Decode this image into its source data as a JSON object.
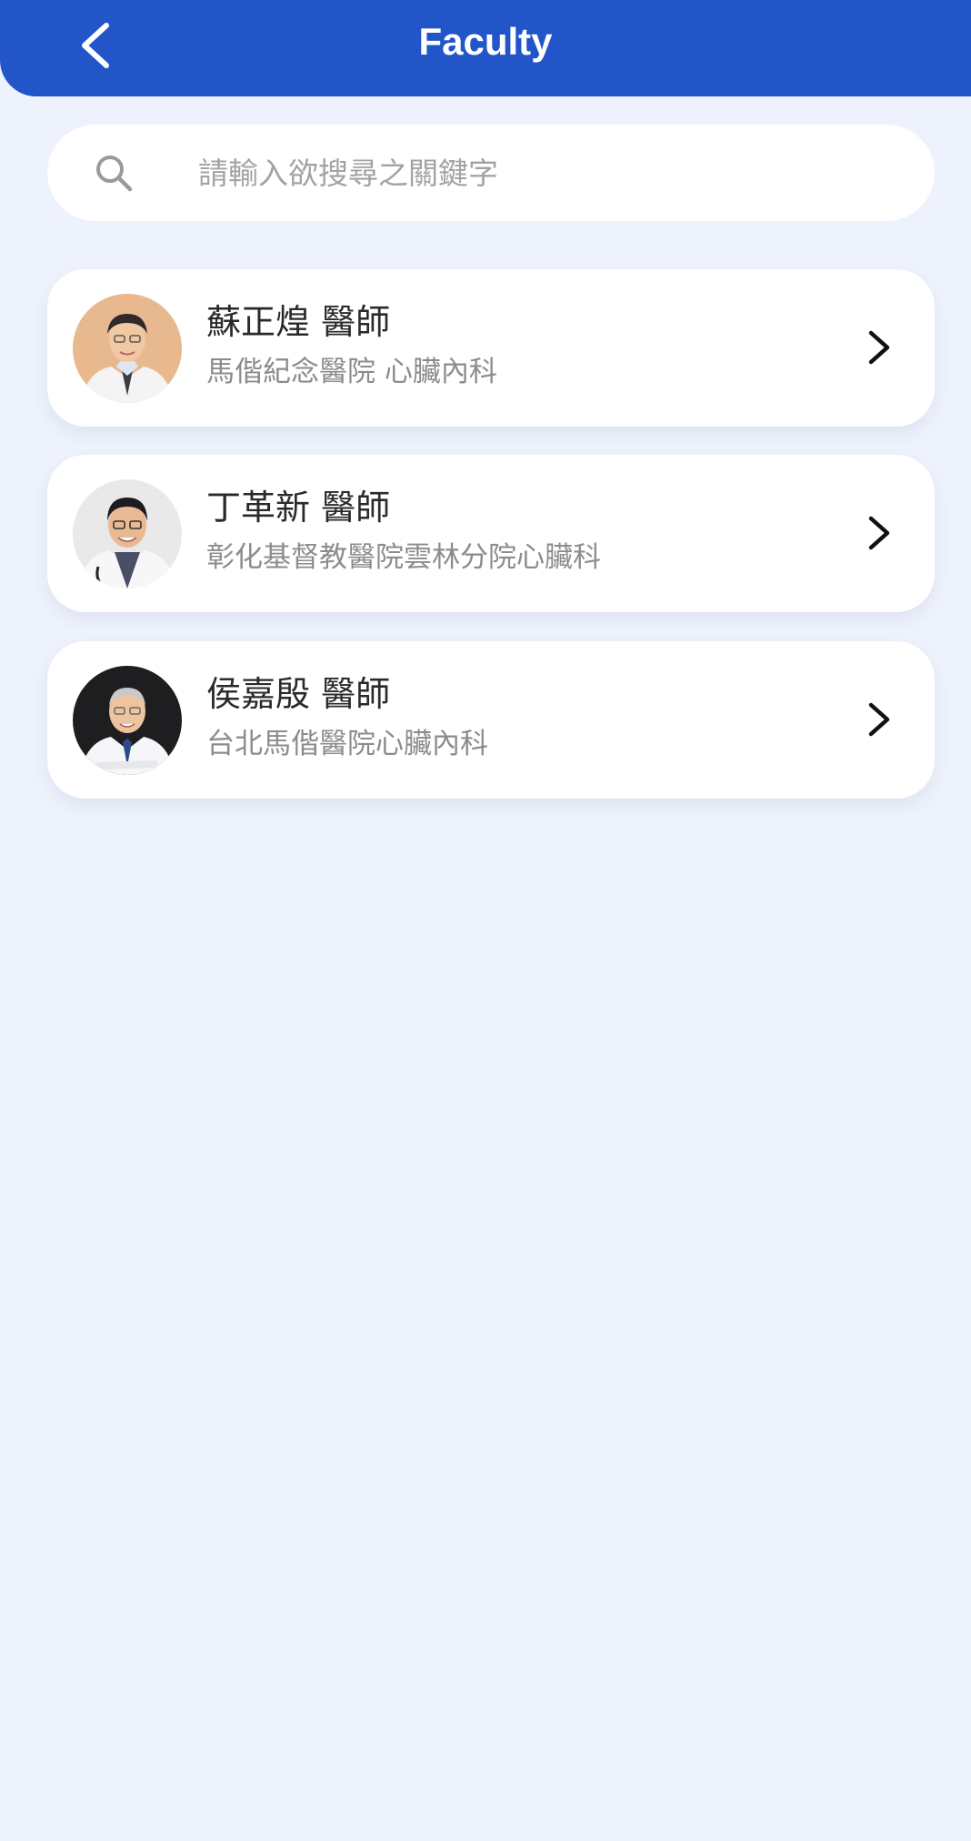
{
  "header": {
    "title": "Faculty",
    "back_icon": "chevron-left-icon",
    "background_color": "#2255c8"
  },
  "search": {
    "placeholder": "請輸入欲搜尋之關鍵字",
    "value": "",
    "icon": "search-icon"
  },
  "faculty": [
    {
      "name": "蘇正煌 醫師",
      "affiliation": "馬偕紀念醫院 心臟內科",
      "avatar": "doctor-photo"
    },
    {
      "name": "丁革新 醫師",
      "affiliation": "彰化基督教醫院雲林分院心臟科",
      "avatar": "doctor-photo"
    },
    {
      "name": "侯嘉殷 醫師",
      "affiliation": "台北馬偕醫院心臟內科",
      "avatar": "doctor-photo"
    }
  ],
  "colors": {
    "page_background": "#eef2fc",
    "card_background": "#ffffff",
    "name_text": "#2a2a2a",
    "secondary_text": "#8c8c8c"
  }
}
